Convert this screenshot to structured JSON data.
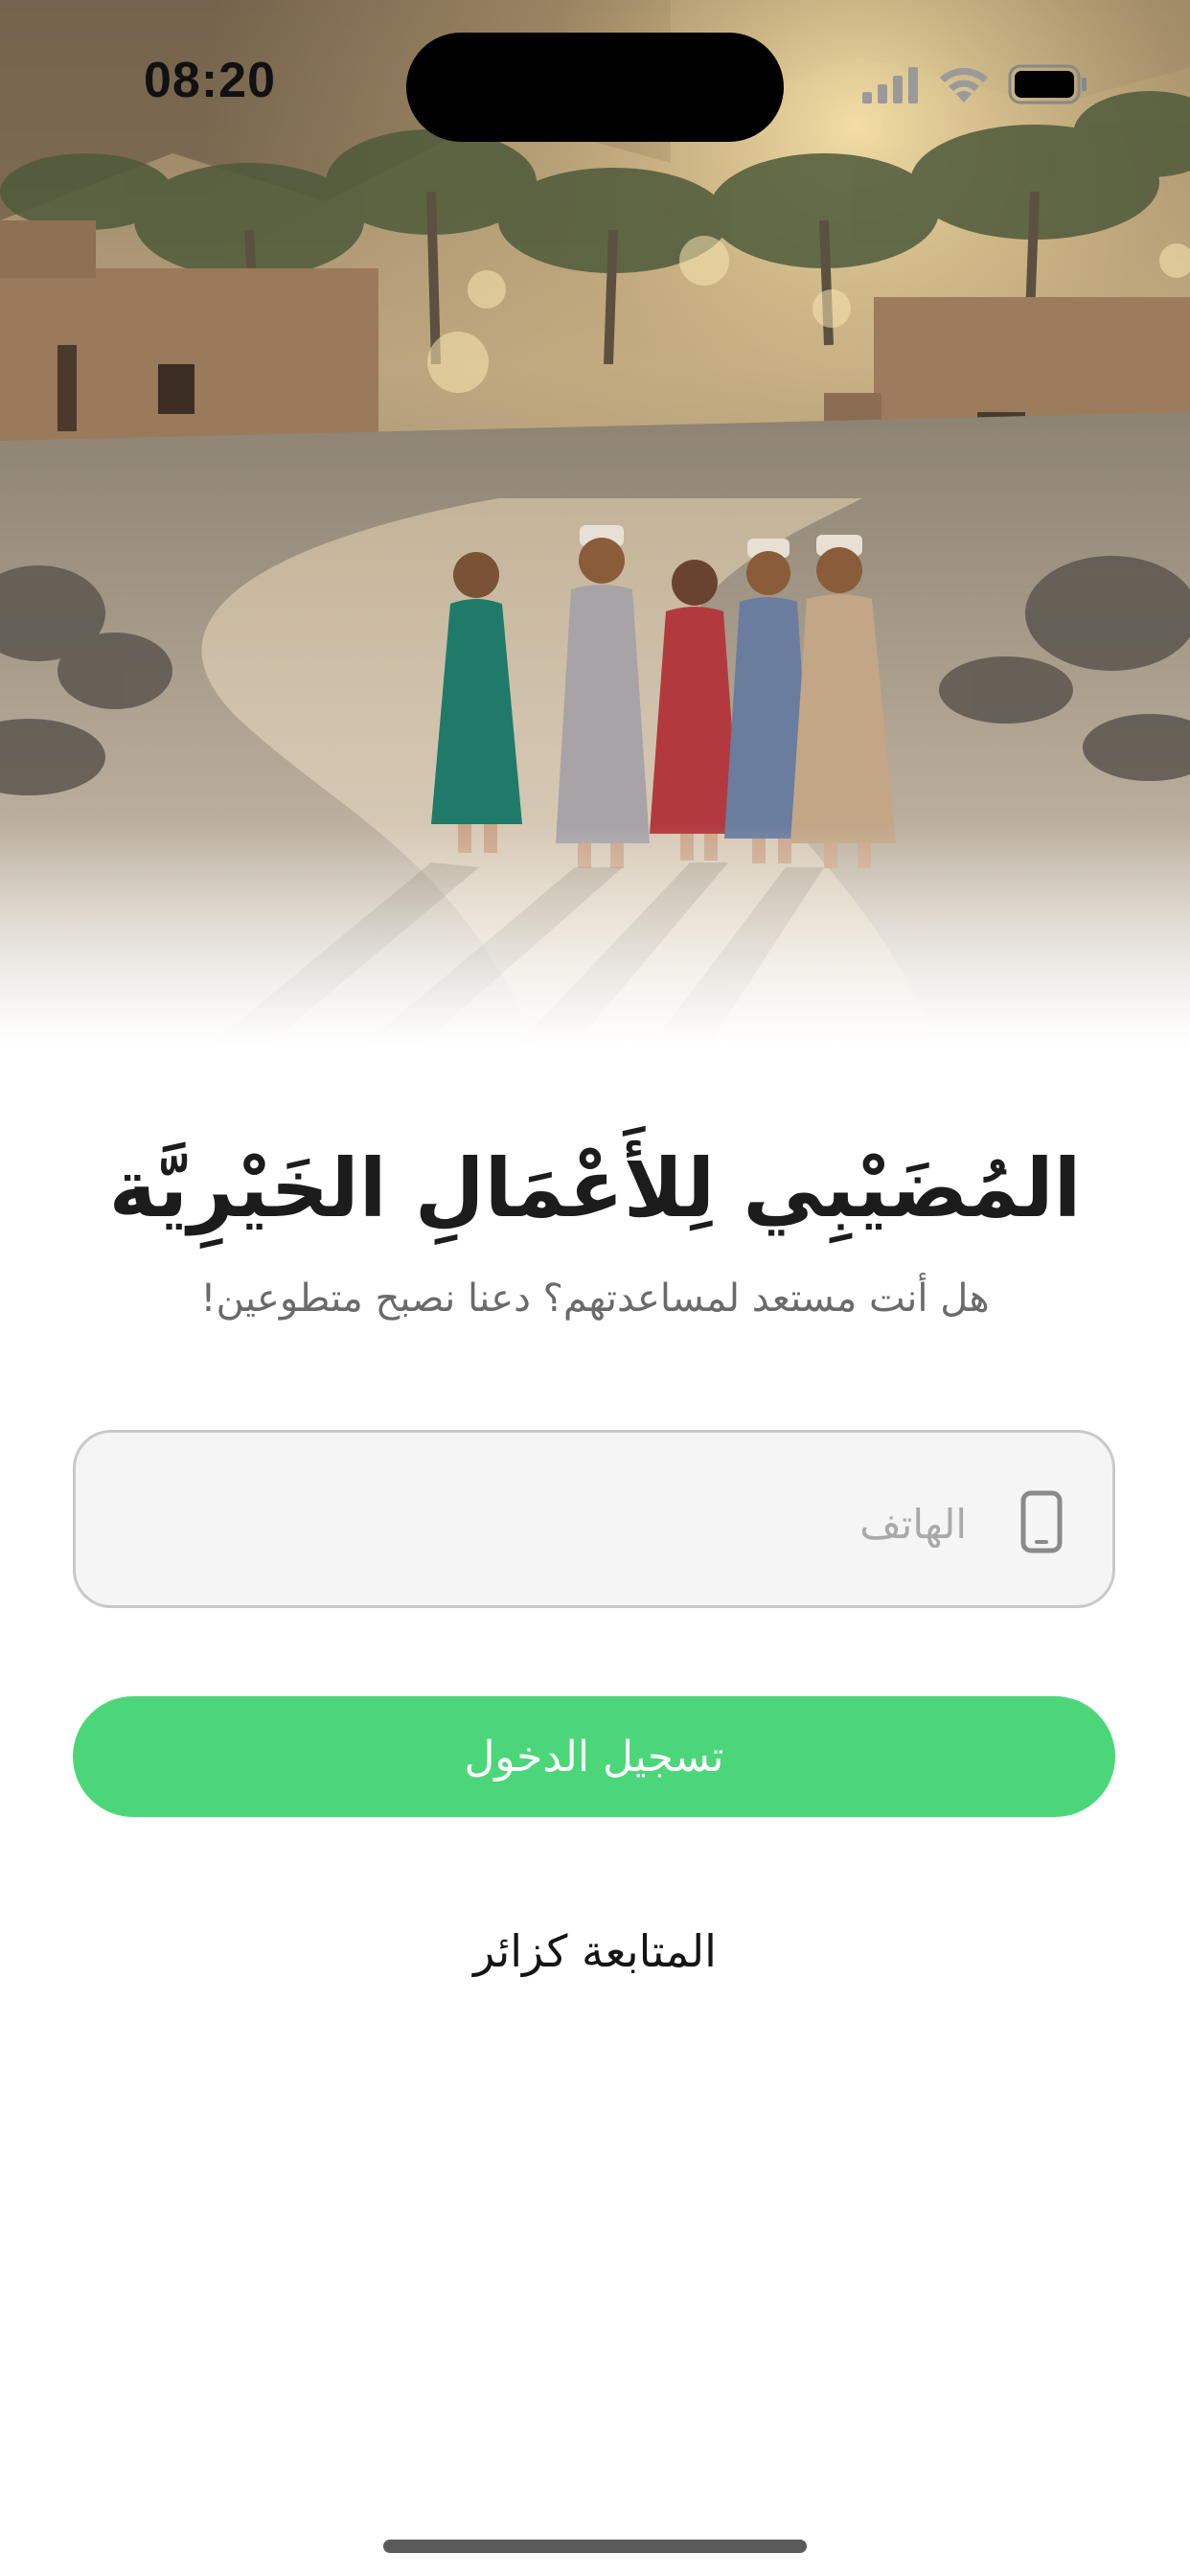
{
  "status_bar": {
    "time": "08:20",
    "icons": [
      "cellular-signal-icon",
      "wifi-icon",
      "battery-icon"
    ]
  },
  "hero": {
    "image": "photo-children-walking-village-road"
  },
  "app": {
    "title": "المُضَيْبِي لِلأَعْمَالِ الخَيْرِيَّة",
    "subtitle": "هل أنت مستعد لمساعدتهم؟ دعنا نصبح متطوعين!"
  },
  "phone_field": {
    "placeholder": "الهاتف",
    "value": "",
    "icon": "mobile-phone-icon"
  },
  "login_button": {
    "label": "تسجيل الدخول"
  },
  "guest_link": {
    "label": "المتابعة كزائر"
  },
  "colors": {
    "primary_green": "#4cd67a",
    "title_text": "#1c1c1c",
    "subtitle_text": "#6a6a6a",
    "field_background": "#f5f5f5",
    "field_border": "#c9c9c9"
  }
}
